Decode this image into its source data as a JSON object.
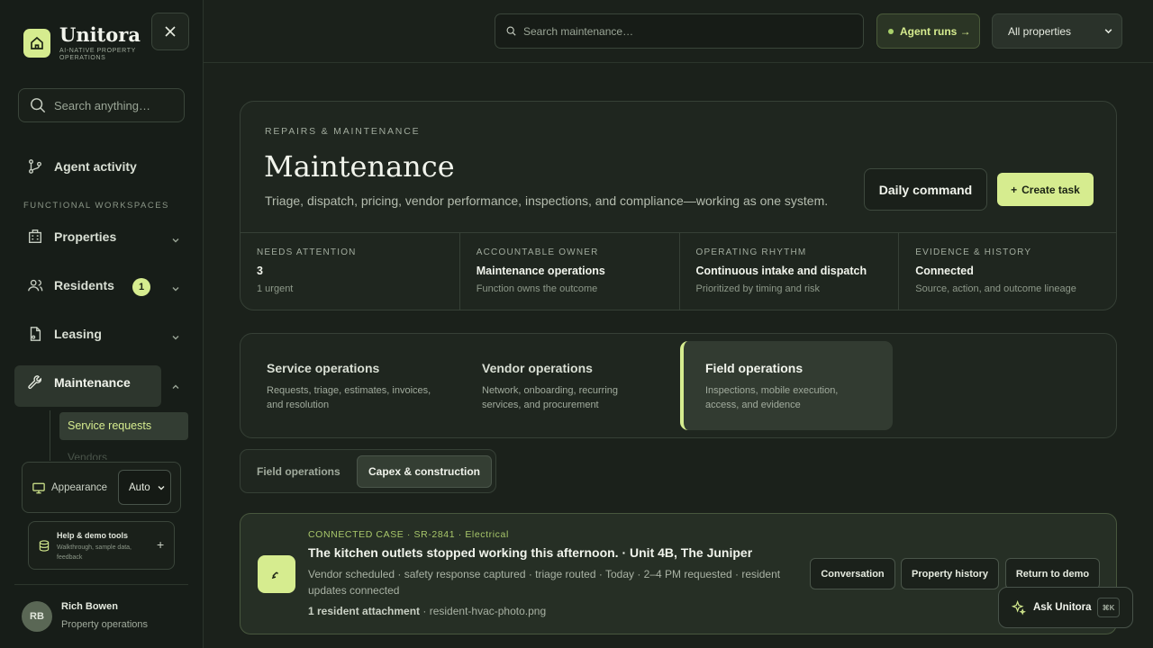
{
  "brand": {
    "name": "Unitora",
    "tagline": "AI-NATIVE PROPERTY OPERATIONS"
  },
  "sidebar": {
    "search_placeholder": "Search anything…",
    "agent_activity": "Agent activity",
    "section_label": "FUNCTIONAL WORKSPACES",
    "items": [
      {
        "label": "Properties",
        "icon": "building-icon"
      },
      {
        "label": "Residents",
        "icon": "users-icon",
        "badge": "1"
      },
      {
        "label": "Leasing",
        "icon": "document-icon"
      },
      {
        "label": "Maintenance",
        "icon": "wrench-icon"
      }
    ],
    "subitems": {
      "active": "Service requests",
      "next": "Vendors"
    },
    "appearance": {
      "label": "Appearance",
      "value": "Auto"
    },
    "help": {
      "title": "Help & demo tools",
      "subtitle": "Walkthrough, sample data, feedback"
    },
    "user": {
      "initials": "RB",
      "name": "Rich Bowen",
      "role": "Property operations"
    }
  },
  "topbar": {
    "search_placeholder": "Search maintenance…",
    "agent_runs": "Agent runs →",
    "property_filter": "All properties"
  },
  "hero": {
    "eyebrow": "REPAIRS & MAINTENANCE",
    "title": "Maintenance",
    "description": "Triage, dispatch, pricing, vendor performance, inspections, and compliance—working as one system.",
    "daily_command": "Daily command",
    "create_task": "Create task",
    "stats": [
      {
        "key": "NEEDS ATTENTION",
        "value": "3",
        "note": "1 urgent"
      },
      {
        "key": "ACCOUNTABLE OWNER",
        "value": "Maintenance operations",
        "note": "Function owns the outcome"
      },
      {
        "key": "OPERATING RHYTHM",
        "value": "Continuous intake and dispatch",
        "note": "Prioritized by timing and risk"
      },
      {
        "key": "EVIDENCE & HISTORY",
        "value": "Connected",
        "note": "Source, action, and outcome lineage"
      }
    ]
  },
  "workspaces": [
    {
      "title": "Service operations",
      "desc": "Requests, triage, estimates, invoices, and resolution"
    },
    {
      "title": "Vendor operations",
      "desc": "Network, onboarding, recurring services, and procurement"
    },
    {
      "title": "Field operations",
      "desc": "Inspections, mobile execution, access, and evidence"
    }
  ],
  "tabs": {
    "first": "Field operations",
    "second": "Capex & construction"
  },
  "case": {
    "meta": "CONNECTED CASE · SR-2841 · Electrical",
    "title": "The kitchen outlets stopped working this afternoon. · Unit 4B, The Juniper",
    "desc": "Vendor scheduled · safety response captured · triage routed · Today · 2–4 PM requested · resident updates connected",
    "attach_bold": "1 resident attachment",
    "attach_file": " · resident-hvac-photo.png",
    "buttons": [
      "Conversation",
      "Property history",
      "Return to demo"
    ]
  },
  "ask": {
    "label": "Ask Unitora",
    "shortcut": "⌘K"
  },
  "colors": {
    "accent": "#d6ec8f",
    "background": "#1b211b",
    "card": "#1f261f"
  }
}
